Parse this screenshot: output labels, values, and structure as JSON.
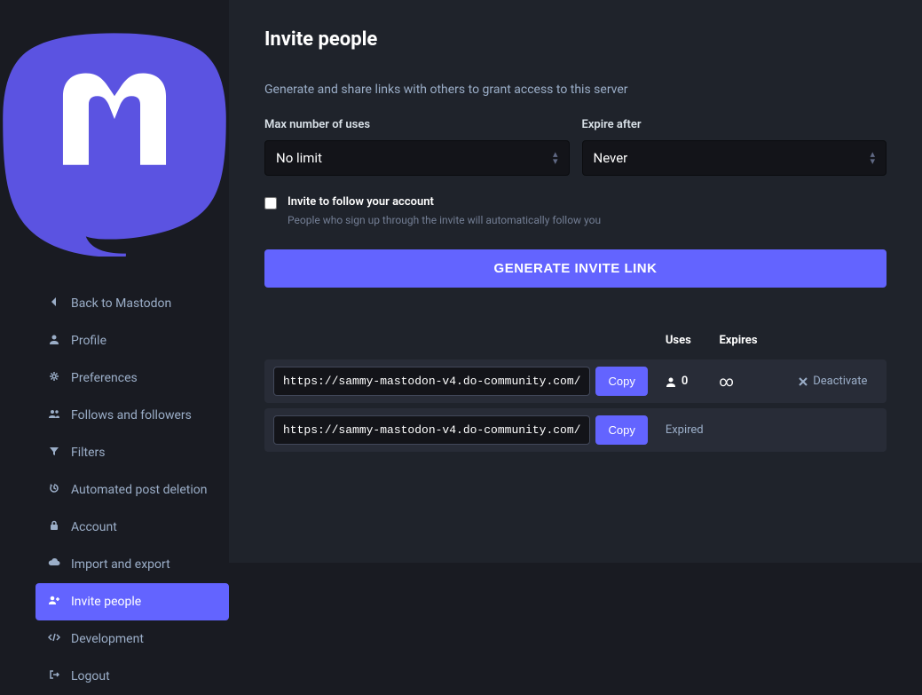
{
  "sidebar": {
    "items": [
      {
        "label": "Back to Mastodon",
        "icon": "chevron-left"
      },
      {
        "label": "Profile",
        "icon": "user"
      },
      {
        "label": "Preferences",
        "icon": "gear"
      },
      {
        "label": "Follows and followers",
        "icon": "users"
      },
      {
        "label": "Filters",
        "icon": "filter"
      },
      {
        "label": "Automated post deletion",
        "icon": "history"
      },
      {
        "label": "Account",
        "icon": "lock"
      },
      {
        "label": "Import and export",
        "icon": "cloud"
      },
      {
        "label": "Invite people",
        "icon": "user-plus",
        "active": true
      },
      {
        "label": "Development",
        "icon": "code"
      },
      {
        "label": "Logout",
        "icon": "signout"
      }
    ]
  },
  "page": {
    "title": "Invite people",
    "subtitle": "Generate and share links with others to grant access to this server",
    "max_uses_label": "Max number of uses",
    "max_uses_value": "No limit",
    "expire_label": "Expire after",
    "expire_value": "Never",
    "invite_follow_label": "Invite to follow your account",
    "invite_follow_hint": "People who sign up through the invite will automatically follow you",
    "generate_button": "Generate invite link"
  },
  "table": {
    "headers": {
      "uses": "Uses",
      "expires": "Expires"
    },
    "copy_label": "Copy",
    "deactivate_label": "Deactivate",
    "expired_label": "Expired",
    "rows": [
      {
        "url": "https://sammy-mastodon-v4.do-community.com/",
        "uses": "0",
        "expires": "∞",
        "active": true
      },
      {
        "url": "https://sammy-mastodon-v4.do-community.com/",
        "expired": true
      }
    ]
  }
}
